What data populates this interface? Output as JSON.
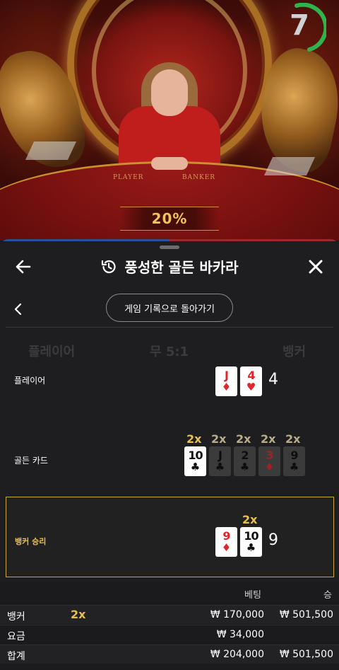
{
  "video": {
    "felt_labels": {
      "player": "PLAYER",
      "banker": "BANKER"
    },
    "percent": "20%",
    "timer": {
      "value": "7",
      "color": "#2fb34a"
    }
  },
  "sheet": {
    "title": "풍성한 골든 바카라",
    "back_history_label": "게임 기록으로 돌아가기",
    "icons": {
      "back": "arrow-left-icon",
      "history": "history-icon",
      "close": "close-icon",
      "prev": "chevron-left-icon"
    },
    "ghost": {
      "player": "플레이어",
      "tie": "무 5:1",
      "banker": "뱅커"
    },
    "rows": {
      "player": {
        "label": "플레이어",
        "cards": [
          {
            "rank": "J",
            "suit": "♦",
            "color": "red"
          },
          {
            "rank": "4",
            "suit": "♥",
            "color": "red"
          }
        ],
        "total": "4"
      },
      "golden": {
        "label": "골든 카드",
        "cards": [
          {
            "rank": "10",
            "suit": "♣",
            "color": "black",
            "mult": "2x",
            "active": true
          },
          {
            "rank": "J",
            "suit": "♣",
            "color": "black",
            "mult": "2x",
            "active": false
          },
          {
            "rank": "2",
            "suit": "♣",
            "color": "black",
            "mult": "2x",
            "active": false
          },
          {
            "rank": "3",
            "suit": "♦",
            "color": "red",
            "mult": "2x",
            "active": false
          },
          {
            "rank": "9",
            "suit": "♣",
            "color": "black",
            "mult": "2x",
            "active": false
          }
        ]
      },
      "banker": {
        "label": "뱅커 승리",
        "cards": [
          {
            "rank": "9",
            "suit": "♦",
            "color": "red"
          },
          {
            "rank": "10",
            "suit": "♣",
            "color": "black",
            "mult": "2x"
          }
        ],
        "total": "9"
      }
    },
    "bets": {
      "col_bet": "베팅",
      "col_win": "승",
      "rows": [
        {
          "name": "뱅커",
          "mult": "2x",
          "bet": "₩ 170,000",
          "win": "₩ 501,500"
        },
        {
          "name": "요금",
          "mult": "",
          "bet": "₩ 34,000",
          "win": ""
        },
        {
          "name": "합계",
          "mult": "",
          "bet": "₩ 204,000",
          "win": "₩ 501,500"
        }
      ]
    }
  }
}
